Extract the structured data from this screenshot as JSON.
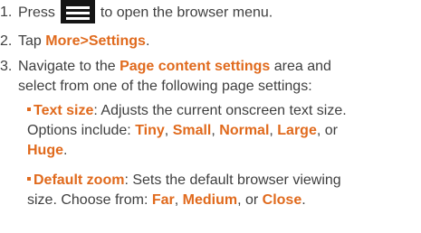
{
  "steps": [
    {
      "num": "1.",
      "pre": "Press",
      "post": "to open the browser menu."
    },
    {
      "num": "2.",
      "pre": "Tap",
      "a": "More",
      "sep": ">",
      "b": "Settings",
      "end": "."
    },
    {
      "num": "3.",
      "l1_pre": "Navigate to the",
      "l1_hl": "Page content settings",
      "l1_post": "area and",
      "l2": "select from one of the following page settings:"
    }
  ],
  "bullets": [
    {
      "title": "Text size",
      "l1_post": ": Adjusts the current onscreen text size.",
      "l2_pre": "Options include: ",
      "opts": [
        "Tiny",
        "Small",
        "Normal",
        "Large"
      ],
      "or": ", or",
      "last": "Huge",
      "end": "."
    },
    {
      "title": "Default zoom",
      "l1_post": ": Sets the default browser viewing",
      "l2_pre": "size. Choose from: ",
      "opts": [
        "Far",
        "Medium"
      ],
      "or": ", or",
      "last": "Close",
      "end": "."
    }
  ],
  "colors": {
    "highlight": "#e06a1d",
    "text": "#3f3f3f",
    "menu_key": "#151515"
  },
  "icons": {
    "menu_key": "menu-key-icon"
  }
}
